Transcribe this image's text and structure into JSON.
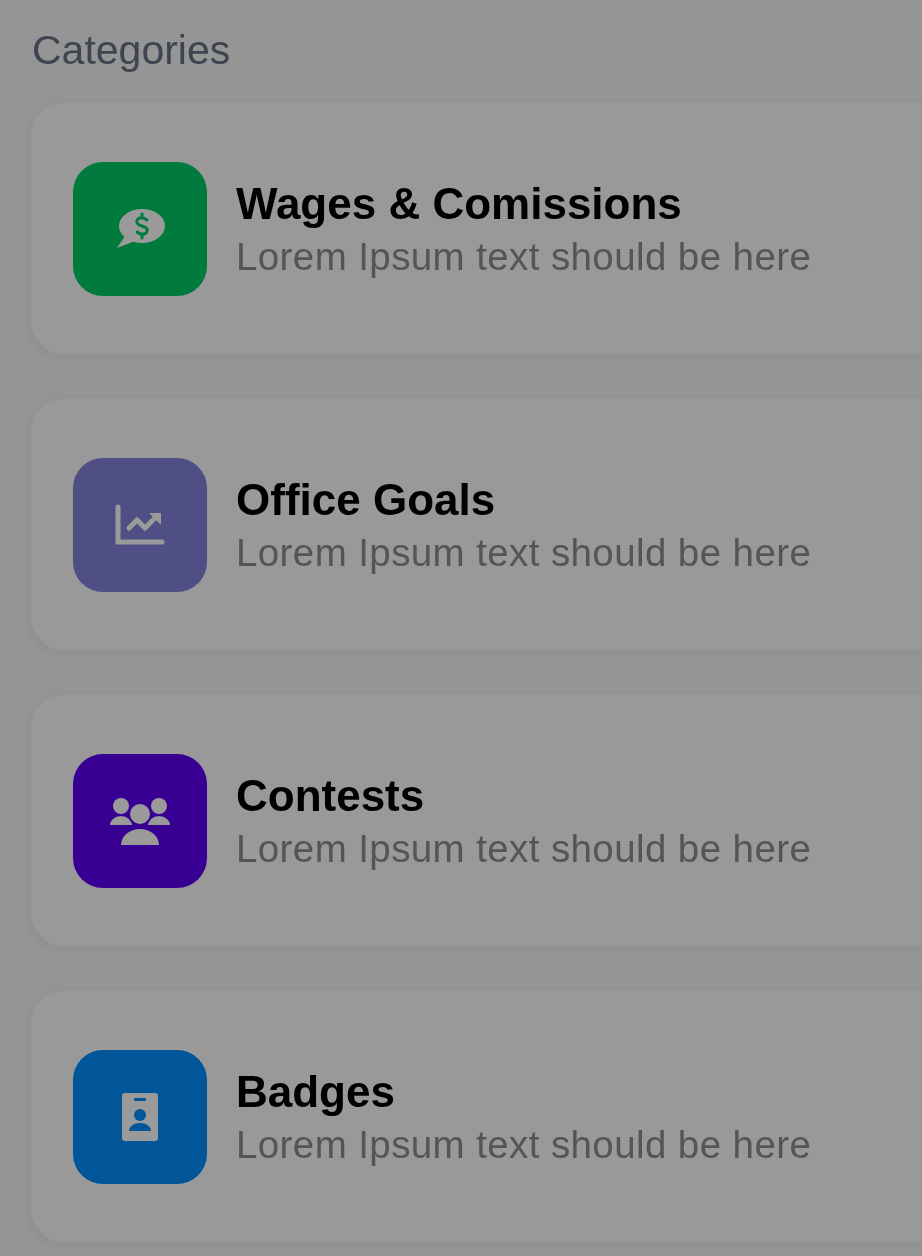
{
  "heading": "Categories",
  "categories": [
    {
      "title": "Wages & Comissions",
      "subtitle": "Lorem Ipsum text should be here",
      "color": "#007a3d",
      "kind": "money"
    },
    {
      "title": "Office Goals",
      "subtitle": "Lorem Ipsum text should be here",
      "color": "#4f4f86",
      "kind": "chart"
    },
    {
      "title": "Contests",
      "subtitle": "Lorem Ipsum text should be here",
      "color": "#380092",
      "kind": "people"
    },
    {
      "title": "Badges",
      "subtitle": "Lorem Ipsum text should be here",
      "color": "#005699",
      "kind": "badge"
    }
  ]
}
